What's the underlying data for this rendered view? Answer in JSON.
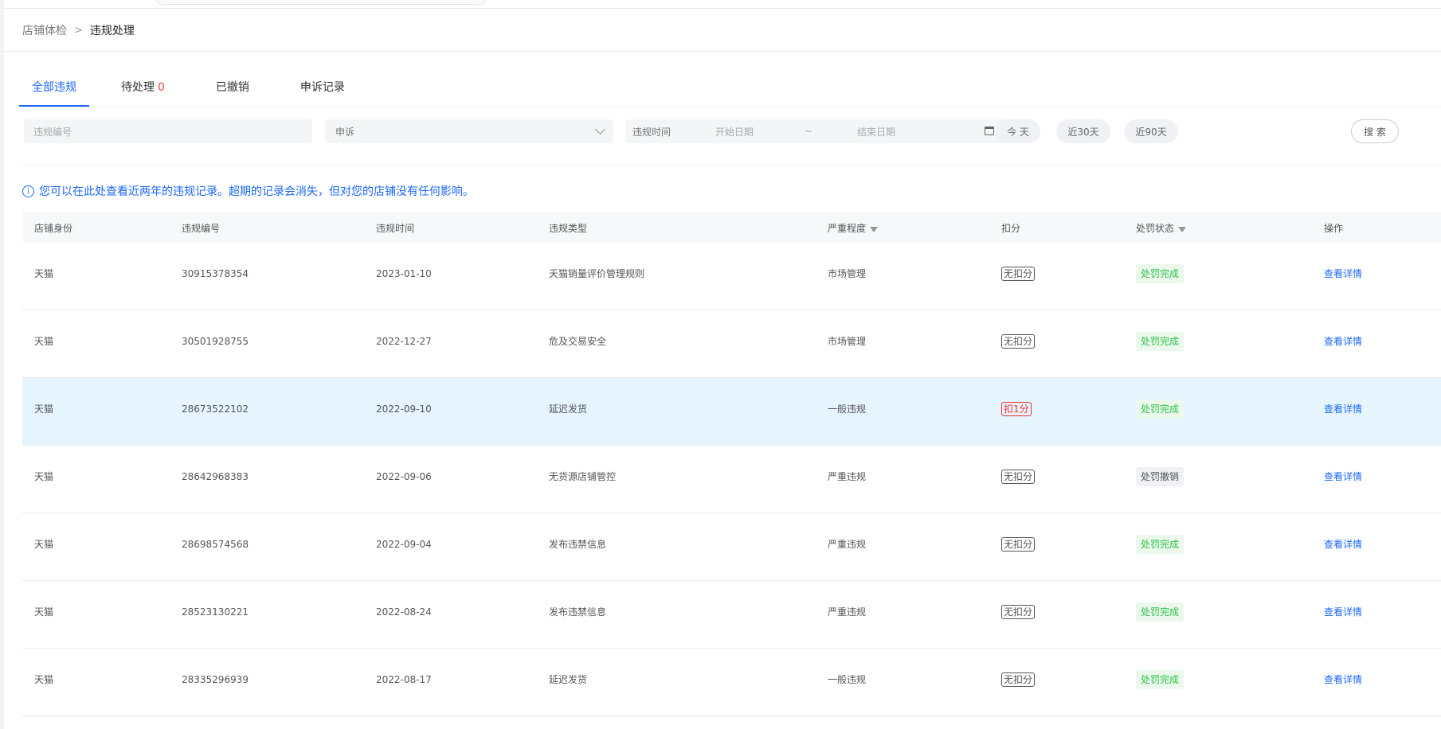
{
  "breadcrumb": {
    "root": "店铺体检",
    "separator": ">",
    "current": "违规处理"
  },
  "tabs": [
    {
      "label": "全部违规",
      "count": ""
    },
    {
      "label": "待处理",
      "count": "0"
    },
    {
      "label": "已撤销",
      "count": ""
    },
    {
      "label": "申诉记录",
      "count": ""
    }
  ],
  "filters": {
    "id_placeholder": "违规编号",
    "appeal_value": "申诉",
    "date_label": "违规时间",
    "start_placeholder": "开始日期",
    "date_separator": "~",
    "end_placeholder": "结束日期",
    "today_label": "今 天",
    "days30_label": "近30天",
    "days90_label": "近90天",
    "search_label": "搜 索"
  },
  "tip": {
    "icon": "info-icon",
    "text": "您可以在此处查看近两年的违规记录。超期的记录会消失，但对您的店铺没有任何影响。"
  },
  "table": {
    "headers": [
      "店铺身份",
      "违规编号",
      "违规时间",
      "违规类型",
      "严重程度",
      "扣分",
      "处罚状态",
      "操作"
    ],
    "rows": [
      {
        "identity": "天猫",
        "id": "30915378354",
        "time": "2023-01-10",
        "type": "天猫销量评价管理规则",
        "severity": "市场管理",
        "score": "无扣分",
        "status": "处罚完成",
        "action": "查看详情"
      },
      {
        "identity": "天猫",
        "id": "30501928755",
        "time": "2022-12-27",
        "type": "危及交易安全",
        "severity": "市场管理",
        "score": "无扣分",
        "status": "处罚完成",
        "action": "查看详情"
      },
      {
        "identity": "天猫",
        "id": "28673522102",
        "time": "2022-09-10",
        "type": "延迟发货",
        "severity": "一般违规",
        "score": "扣1分",
        "status": "处罚完成",
        "action": "查看详情"
      },
      {
        "identity": "天猫",
        "id": "28642968383",
        "time": "2022-09-06",
        "type": "无货源店铺管控",
        "severity": "严重违规",
        "score": "无扣分",
        "status": "处罚撤销",
        "action": "查看详情"
      },
      {
        "identity": "天猫",
        "id": "28698574568",
        "time": "2022-09-04",
        "type": "发布违禁信息",
        "severity": "严重违规",
        "score": "无扣分",
        "status": "处罚完成",
        "action": "查看详情"
      },
      {
        "identity": "天猫",
        "id": "28523130221",
        "time": "2022-08-24",
        "type": "发布违禁信息",
        "severity": "严重违规",
        "score": "无扣分",
        "status": "处罚完成",
        "action": "查看详情"
      },
      {
        "identity": "天猫",
        "id": "28335296939",
        "time": "2022-08-17",
        "type": "延迟发货",
        "severity": "一般违规",
        "score": "无扣分",
        "status": "处罚完成",
        "action": "查看详情"
      }
    ]
  },
  "colors": {
    "accent": "#1b67ff",
    "success": "#30c24a",
    "danger": "#e33333",
    "highlight_row": "#e5f4fd"
  }
}
